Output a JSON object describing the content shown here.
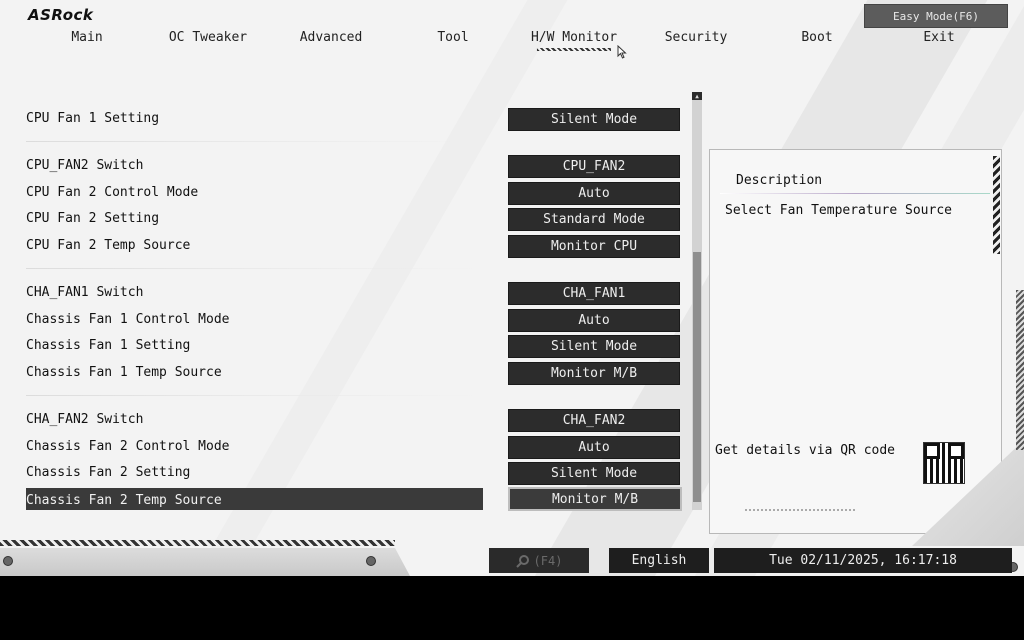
{
  "brand": {
    "logo_text": "ASRock"
  },
  "header": {
    "easy_mode_label": "Easy Mode(F6)"
  },
  "nav": {
    "tabs": [
      {
        "label": "Main"
      },
      {
        "label": "OC Tweaker"
      },
      {
        "label": "Advanced"
      },
      {
        "label": "Tool"
      },
      {
        "label": "H/W Monitor"
      },
      {
        "label": "Security"
      },
      {
        "label": "Boot"
      },
      {
        "label": "Exit"
      }
    ],
    "active_tab": "H/W Monitor"
  },
  "settings": [
    {
      "label": "CPU Fan 1 Setting",
      "value": "Silent Mode"
    },
    {
      "label": "CPU_FAN2 Switch",
      "value": "CPU_FAN2"
    },
    {
      "label": "CPU Fan 2 Control Mode",
      "value": "Auto"
    },
    {
      "label": "CPU Fan 2 Setting",
      "value": "Standard Mode"
    },
    {
      "label": "CPU Fan 2 Temp Source",
      "value": "Monitor CPU"
    },
    {
      "label": "CHA_FAN1 Switch",
      "value": "CHA_FAN1"
    },
    {
      "label": "Chassis Fan 1 Control Mode",
      "value": "Auto"
    },
    {
      "label": "Chassis Fan 1 Setting",
      "value": "Silent Mode"
    },
    {
      "label": "Chassis Fan 1 Temp Source",
      "value": "Monitor M/B"
    },
    {
      "label": "CHA_FAN2 Switch",
      "value": "CHA_FAN2"
    },
    {
      "label": "Chassis Fan 2 Control Mode",
      "value": "Auto"
    },
    {
      "label": "Chassis Fan 2 Setting",
      "value": "Silent Mode"
    },
    {
      "label": "Chassis Fan 2 Temp Source",
      "value": "Monitor M/B"
    }
  ],
  "selected_setting": "Chassis Fan 2 Temp Source",
  "description": {
    "title": "Description",
    "text": "Select Fan Temperature Source",
    "qr_text": "Get details via QR code"
  },
  "footer": {
    "search_label": "(F4)",
    "language": "English",
    "datetime": "Tue 02/11/2025, 16:17:18"
  },
  "icons": [
    "search-icon",
    "qr-code-icon",
    "mouse-pointer-icon"
  ],
  "colors": {
    "value_box": "#2c2c2c",
    "background": "#f3f3f3",
    "selected_row": "#3a3a3a"
  }
}
